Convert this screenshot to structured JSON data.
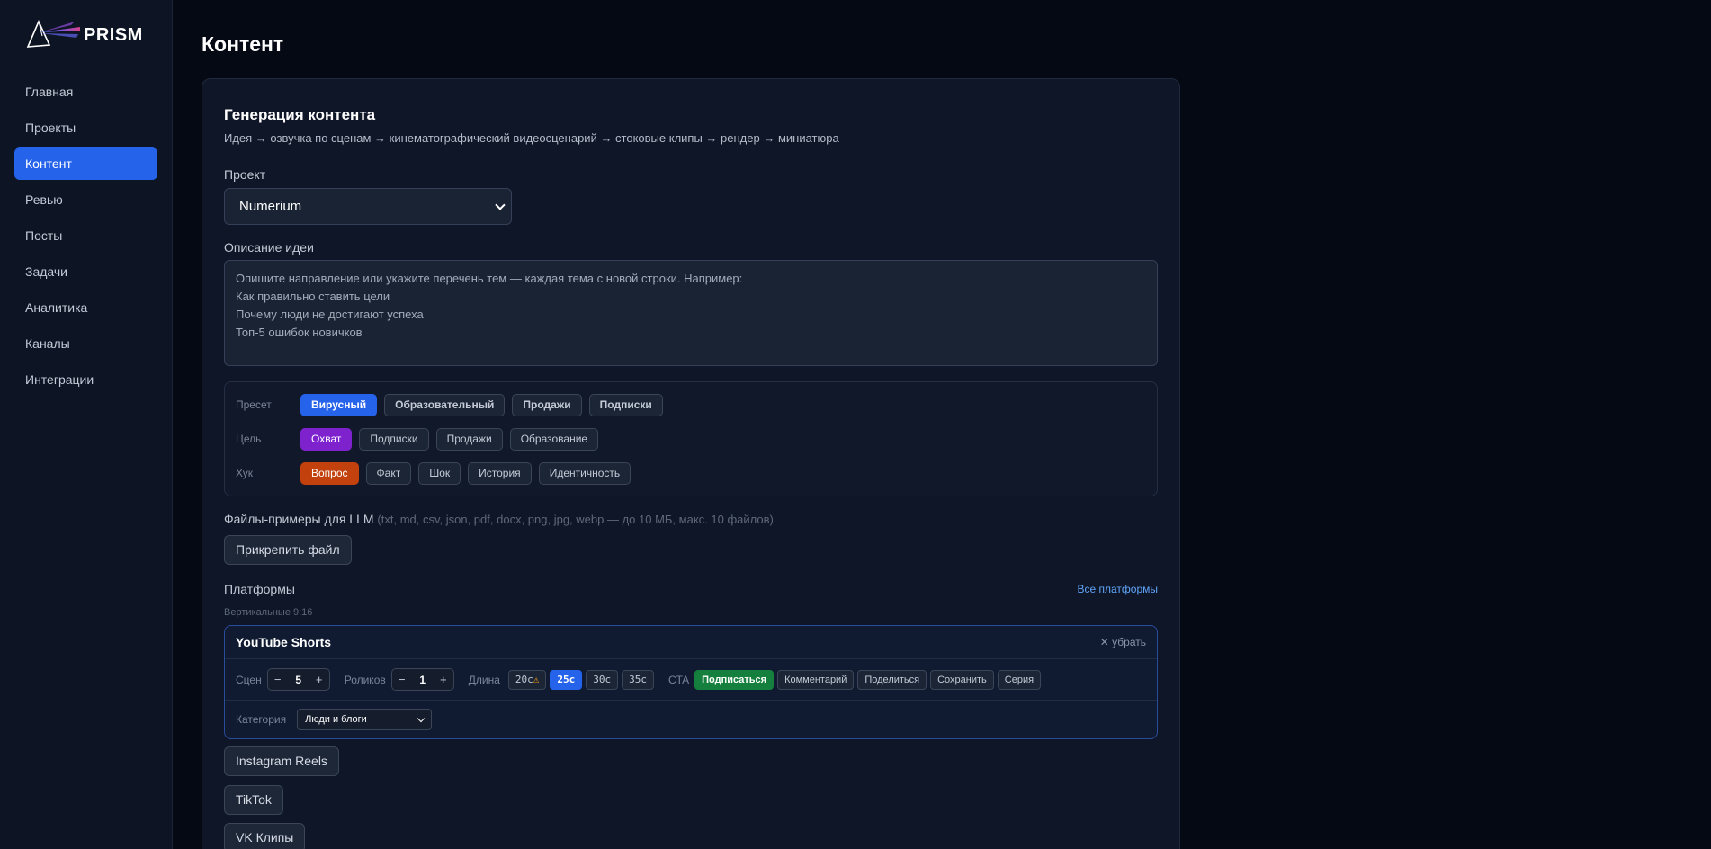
{
  "app": {
    "name": "PRISM"
  },
  "sidebar": {
    "items": [
      {
        "label": "Главная",
        "active": false
      },
      {
        "label": "Проекты",
        "active": false
      },
      {
        "label": "Контент",
        "active": true
      },
      {
        "label": "Ревью",
        "active": false
      },
      {
        "label": "Посты",
        "active": false
      },
      {
        "label": "Задачи",
        "active": false
      },
      {
        "label": "Аналитика",
        "active": false
      },
      {
        "label": "Каналы",
        "active": false
      },
      {
        "label": "Интеграции",
        "active": false
      }
    ]
  },
  "page": {
    "title": "Контент"
  },
  "generation": {
    "title": "Генерация контента",
    "subtitle": "Идея → озвучка по сценам → кинематографический видеосценарий → стоковые клипы → рендер → миниатюра",
    "project_label": "Проект",
    "project_value": "Numerium",
    "idea_label": "Описание идеи",
    "idea_placeholder": "Опишите направление или укажите перечень тем — каждая тема с новой строки. Например:\nКак правильно ставить цели\nПочему люди не достигают успеха\nТоп-5 ошибок новичков"
  },
  "preset": {
    "label": "Пресет",
    "options": [
      "Вирусный",
      "Образовательный",
      "Продажи",
      "Подписки"
    ],
    "selected": "Вирусный"
  },
  "goal": {
    "label": "Цель",
    "options": [
      "Охват",
      "Подписки",
      "Продажи",
      "Образование"
    ],
    "selected": "Охват"
  },
  "hook": {
    "label": "Хук",
    "options": [
      "Вопрос",
      "Факт",
      "Шок",
      "История",
      "Идентичность"
    ],
    "selected": "Вопрос"
  },
  "files": {
    "label": "Файлы-примеры для LLM",
    "hint": "(txt, md, csv, json, pdf, docx, png, jpg, webp — до 10 МБ, макс. 10 файлов)",
    "attach_button": "Прикрепить файл"
  },
  "platforms": {
    "label": "Платформы",
    "all_link": "Все платформы",
    "vertical_label": "Вертикальные 9:16",
    "youtube": {
      "title": "YouTube Shorts",
      "remove": "убрать",
      "scenes_label": "Сцен",
      "scenes_value": "5",
      "videos_label": "Роликов",
      "videos_value": "1",
      "length_label": "Длина",
      "lengths": [
        "20с",
        "25с",
        "30с",
        "35с"
      ],
      "length_selected": "25с",
      "warn_icon": "⚠",
      "cta_label": "CTA",
      "cta_options": [
        "Подписаться",
        "Комментарий",
        "Поделиться",
        "Сохранить",
        "Серия"
      ],
      "cta_selected": "Подписаться",
      "category_label": "Категория",
      "category_value": "Люди и блоги"
    },
    "others": [
      "Instagram Reels",
      "TikTok",
      "VK Клипы"
    ]
  },
  "colors": {
    "accent": "#2563eb",
    "goal_active": "#7e22ce",
    "hook_active": "#c2410c",
    "cta_active": "#15803d",
    "link": "#60a5fa"
  }
}
